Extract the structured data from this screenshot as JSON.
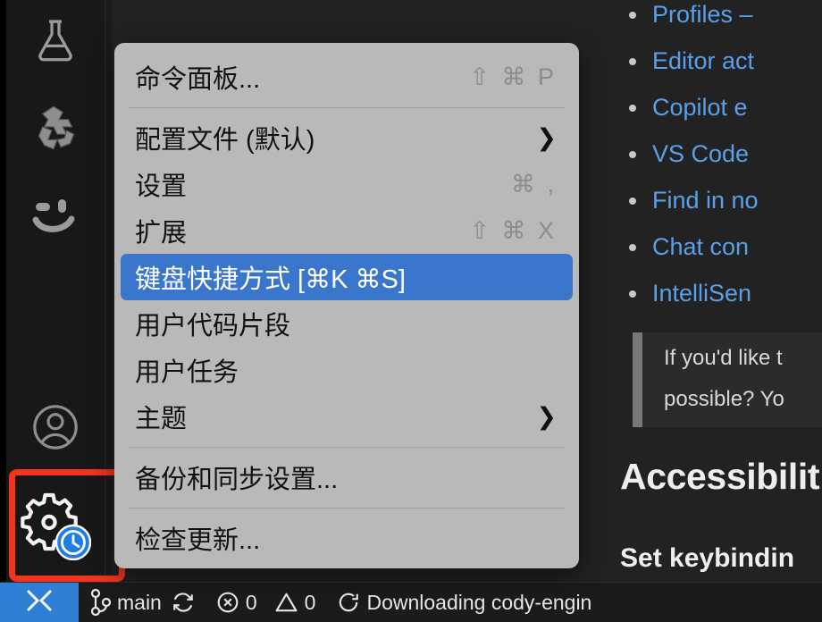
{
  "app": {
    "accent_blue": "#3a76cc",
    "menu_bg": "#b9b9b9",
    "annotation_color": "#f4341d",
    "link_color": "#5aa0e8"
  },
  "activity_bar": {
    "items": [
      {
        "name": "beaker-icon",
        "label": "Testing"
      },
      {
        "name": "sourcegraph-cody-icon",
        "label": "Cody"
      },
      {
        "name": "smiley-icon",
        "label": "Smiley"
      },
      {
        "name": "account-icon",
        "label": "Accounts"
      },
      {
        "name": "gear-icon",
        "label": "Manage",
        "badge": "clock-badge"
      }
    ]
  },
  "context_menu": {
    "groups": [
      {
        "items": [
          {
            "label": "命令面板...",
            "accel": "⇧ ⌘ P",
            "submenu": false,
            "selected": false
          }
        ]
      },
      {
        "items": [
          {
            "label": "配置文件 (默认)",
            "accel": "",
            "submenu": true,
            "selected": false
          },
          {
            "label": "设置",
            "accel": "⌘ ,",
            "submenu": false,
            "selected": false
          },
          {
            "label": "扩展",
            "accel": "⇧ ⌘ X",
            "submenu": false,
            "selected": false
          },
          {
            "label": "键盘快捷方式 [⌘K ⌘S]",
            "accel": "",
            "submenu": false,
            "selected": true
          },
          {
            "label": "用户代码片段",
            "accel": "",
            "submenu": false,
            "selected": false
          },
          {
            "label": "用户任务",
            "accel": "",
            "submenu": false,
            "selected": false
          },
          {
            "label": "主题",
            "accel": "",
            "submenu": true,
            "selected": false
          }
        ]
      },
      {
        "items": [
          {
            "label": "备份和同步设置...",
            "accel": "",
            "submenu": false,
            "selected": false
          }
        ]
      },
      {
        "items": [
          {
            "label": "检查更新...",
            "accel": "",
            "submenu": false,
            "selected": false
          }
        ]
      }
    ]
  },
  "document": {
    "links": [
      "Profiles –",
      "Editor act",
      "Copilot e",
      "VS Code",
      "Find in no",
      "Chat con",
      "IntelliSen"
    ],
    "quote_lines": [
      "If you'd like t",
      "possible? Yo"
    ],
    "heading1": "Accessibilit",
    "heading2": "Set keybindin"
  },
  "status_bar": {
    "remote_icon": "remote-window-icon",
    "branch": "main",
    "sync_icon": "sync-icon",
    "errors": "0",
    "warnings": "0",
    "notification": "Downloading cody-engin"
  }
}
